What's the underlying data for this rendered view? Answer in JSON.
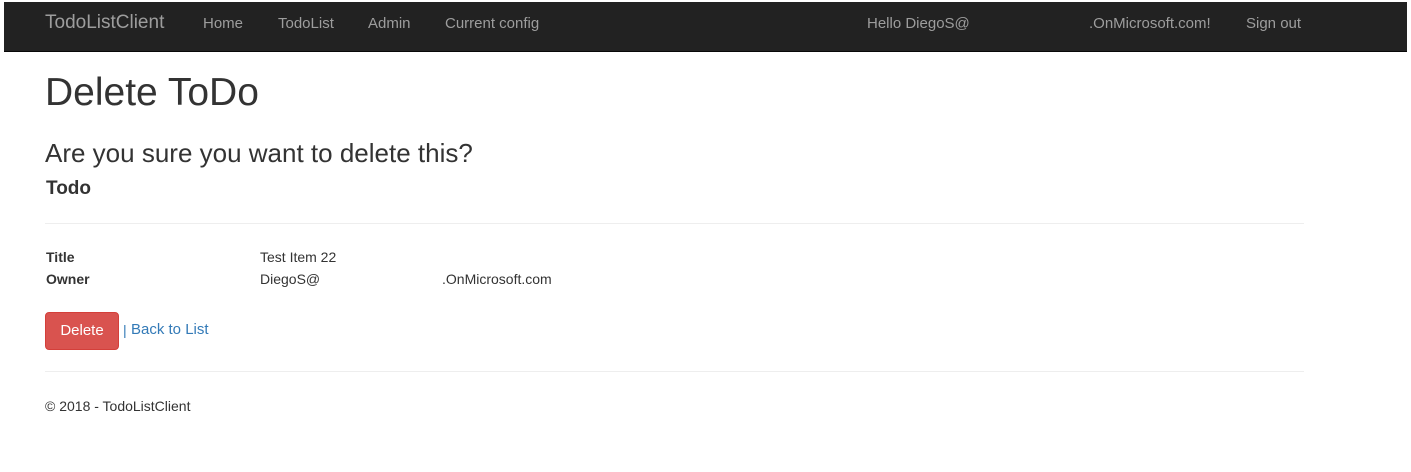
{
  "navbar": {
    "brand": "TodoListClient",
    "links": {
      "home": "Home",
      "todolist": "TodoList",
      "admin": "Admin",
      "current_config": "Current config"
    },
    "greeting": "Hello DiegoS@",
    "greeting_domain": ".OnMicrosoft.com!",
    "sign_out": "Sign out"
  },
  "main": {
    "title": "Delete ToDo",
    "question": "Are you sure you want to delete this?",
    "subheading": "Todo",
    "details": {
      "title_label": "Title",
      "title_value": "Test Item 22",
      "owner_label": "Owner",
      "owner_value": "DiegoS@",
      "owner_domain": ".OnMicrosoft.com"
    },
    "actions": {
      "delete_label": "Delete",
      "separator": "|",
      "back_label": "Back to List"
    }
  },
  "footer": {
    "text": "© 2018 - TodoListClient"
  },
  "colors": {
    "navbar_bg": "#222222",
    "nav_text": "#9d9d9d",
    "danger": "#d9534f",
    "link": "#337ab7"
  }
}
